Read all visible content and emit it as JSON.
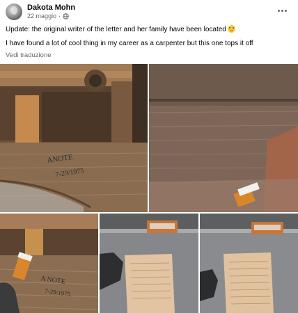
{
  "post": {
    "author": "Dakota Mohn",
    "date": "22 maggio",
    "separator": "·",
    "lines": [
      "Update: the original writer of the letter and her family have been located",
      "I have found a lot of cool thing in my career as a carpenter but this one tops it off"
    ],
    "translate_label": "Vedi traduzione"
  },
  "photos": {
    "photo1_inscription_line1": "ANOTE",
    "photo1_inscription_line2": "7-29/1975",
    "photo3_inscription_line1": "A NOTE",
    "photo3_inscription_line2": "7-29/1975"
  },
  "icons": {
    "privacy": "globe-icon",
    "more": "more-options-icon",
    "emoji": "smiling-face-emoji"
  }
}
